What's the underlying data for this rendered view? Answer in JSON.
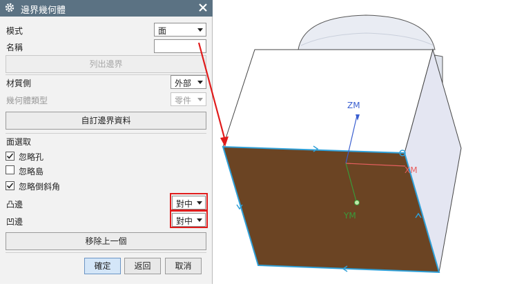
{
  "dialog": {
    "title": "邊界幾何體",
    "mode_label": "模式",
    "mode_value": "面",
    "name_label": "名稱",
    "name_value": "",
    "list_boundary_button": "列出邊界",
    "material_side_label": "材質側",
    "material_side_value": "外部",
    "geometry_type_label": "幾何體類型",
    "geometry_type_value": "零件",
    "custom_boundary_button": "自訂邊界資料",
    "face_selection_label": "面選取",
    "checkboxes": [
      {
        "label": "忽略孔",
        "checked": true
      },
      {
        "label": "忽略島",
        "checked": false
      },
      {
        "label": "忽略倒斜角",
        "checked": true
      }
    ],
    "convex_edge_label": "凸邊",
    "convex_edge_value": "對中",
    "concave_edge_label": "凹邊",
    "concave_edge_value": "對中",
    "remove_previous_button": "移除上一個",
    "ok_button": "確定",
    "back_button": "返回",
    "cancel_button": "取消"
  },
  "viewport": {
    "axis_z_label": "ZM",
    "axis_x_label": "XM",
    "axis_y_label": "YM",
    "face_color": "#6b4423",
    "boundary_color": "#2fa0d8",
    "callout_arrow_color": "#e01b1b"
  },
  "icons": {
    "settings": "gear-icon",
    "close": "close-icon",
    "dropdown": "chevron-down-icon"
  }
}
